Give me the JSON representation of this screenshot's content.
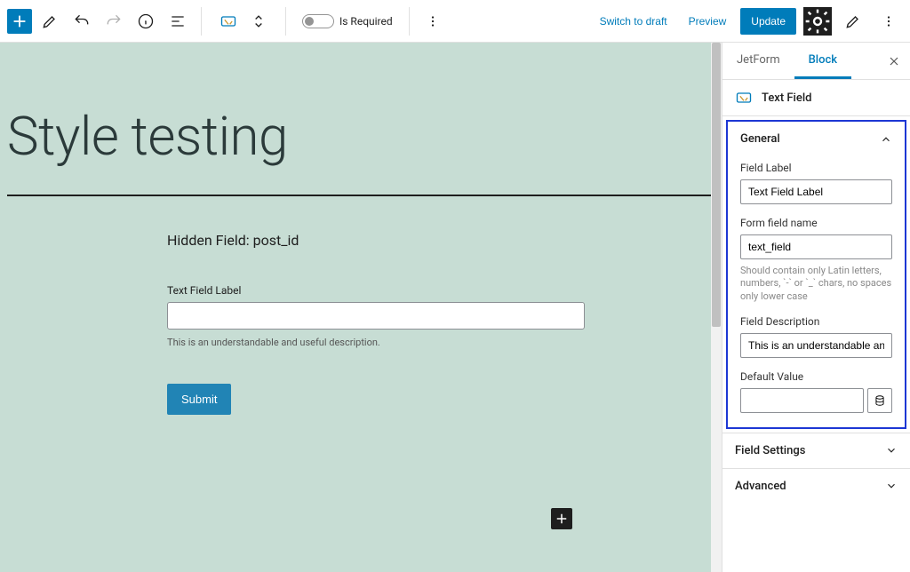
{
  "topbar": {
    "is_required_label": "Is Required",
    "switch_draft": "Switch to draft",
    "preview": "Preview",
    "update": "Update"
  },
  "canvas": {
    "page_title": "Style testing",
    "hidden_field": "Hidden Field: post_id",
    "text_field_label": "Text Field Label",
    "text_field_description": "This is an understandable and useful description.",
    "submit": "Submit"
  },
  "sidebar": {
    "tabs": {
      "jetform": "JetForm",
      "block": "Block"
    },
    "block_title": "Text Field",
    "general": {
      "title": "General",
      "field_label": {
        "label": "Field Label",
        "value": "Text Field Label"
      },
      "form_field_name": {
        "label": "Form field name",
        "value": "text_field",
        "help": "Should contain only Latin letters, numbers, `-` or `_` chars, no spaces only lower case"
      },
      "field_description": {
        "label": "Field Description",
        "value": "This is an understandable and useful description."
      },
      "default_value": {
        "label": "Default Value",
        "value": ""
      }
    },
    "field_settings": "Field Settings",
    "advanced": "Advanced"
  }
}
